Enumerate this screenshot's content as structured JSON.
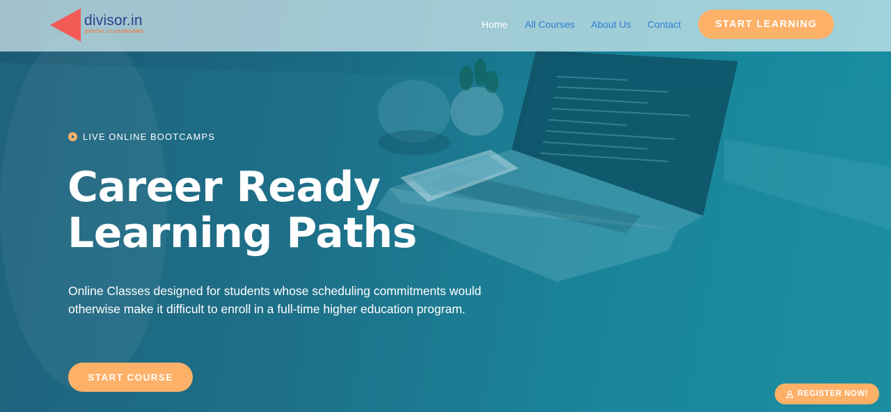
{
  "brand": {
    "name": "divisor.in",
    "tagline": "Digital Classrooms",
    "logo_icon": "play-triangle-logo",
    "logo_color": "#f25a55"
  },
  "nav": {
    "items": [
      {
        "label": "Home",
        "active": true
      },
      {
        "label": "All Courses",
        "active": false
      },
      {
        "label": "About Us",
        "active": false
      },
      {
        "label": "Contact",
        "active": false
      }
    ],
    "cta_label": "START LEARNING"
  },
  "hero": {
    "eyebrow_icon": "play-circle-icon",
    "eyebrow": "LIVE ONLINE BOOTCAMPS",
    "title_lines": [
      "Career Ready",
      "Learning Paths"
    ],
    "description": "Online Classes designed for students whose scheduling commitments would otherwise make it difficult to enroll in a full-time higher education program.",
    "cta_label": "START COURSE"
  },
  "register": {
    "icon": "user-icon",
    "label": "REGISTER NOW!"
  },
  "colors": {
    "accent_orange": "#fdb067",
    "nav_link": "#2e7fd1",
    "hero_overlay": "#1b6e86",
    "logo_text": "#2b3f8c"
  }
}
